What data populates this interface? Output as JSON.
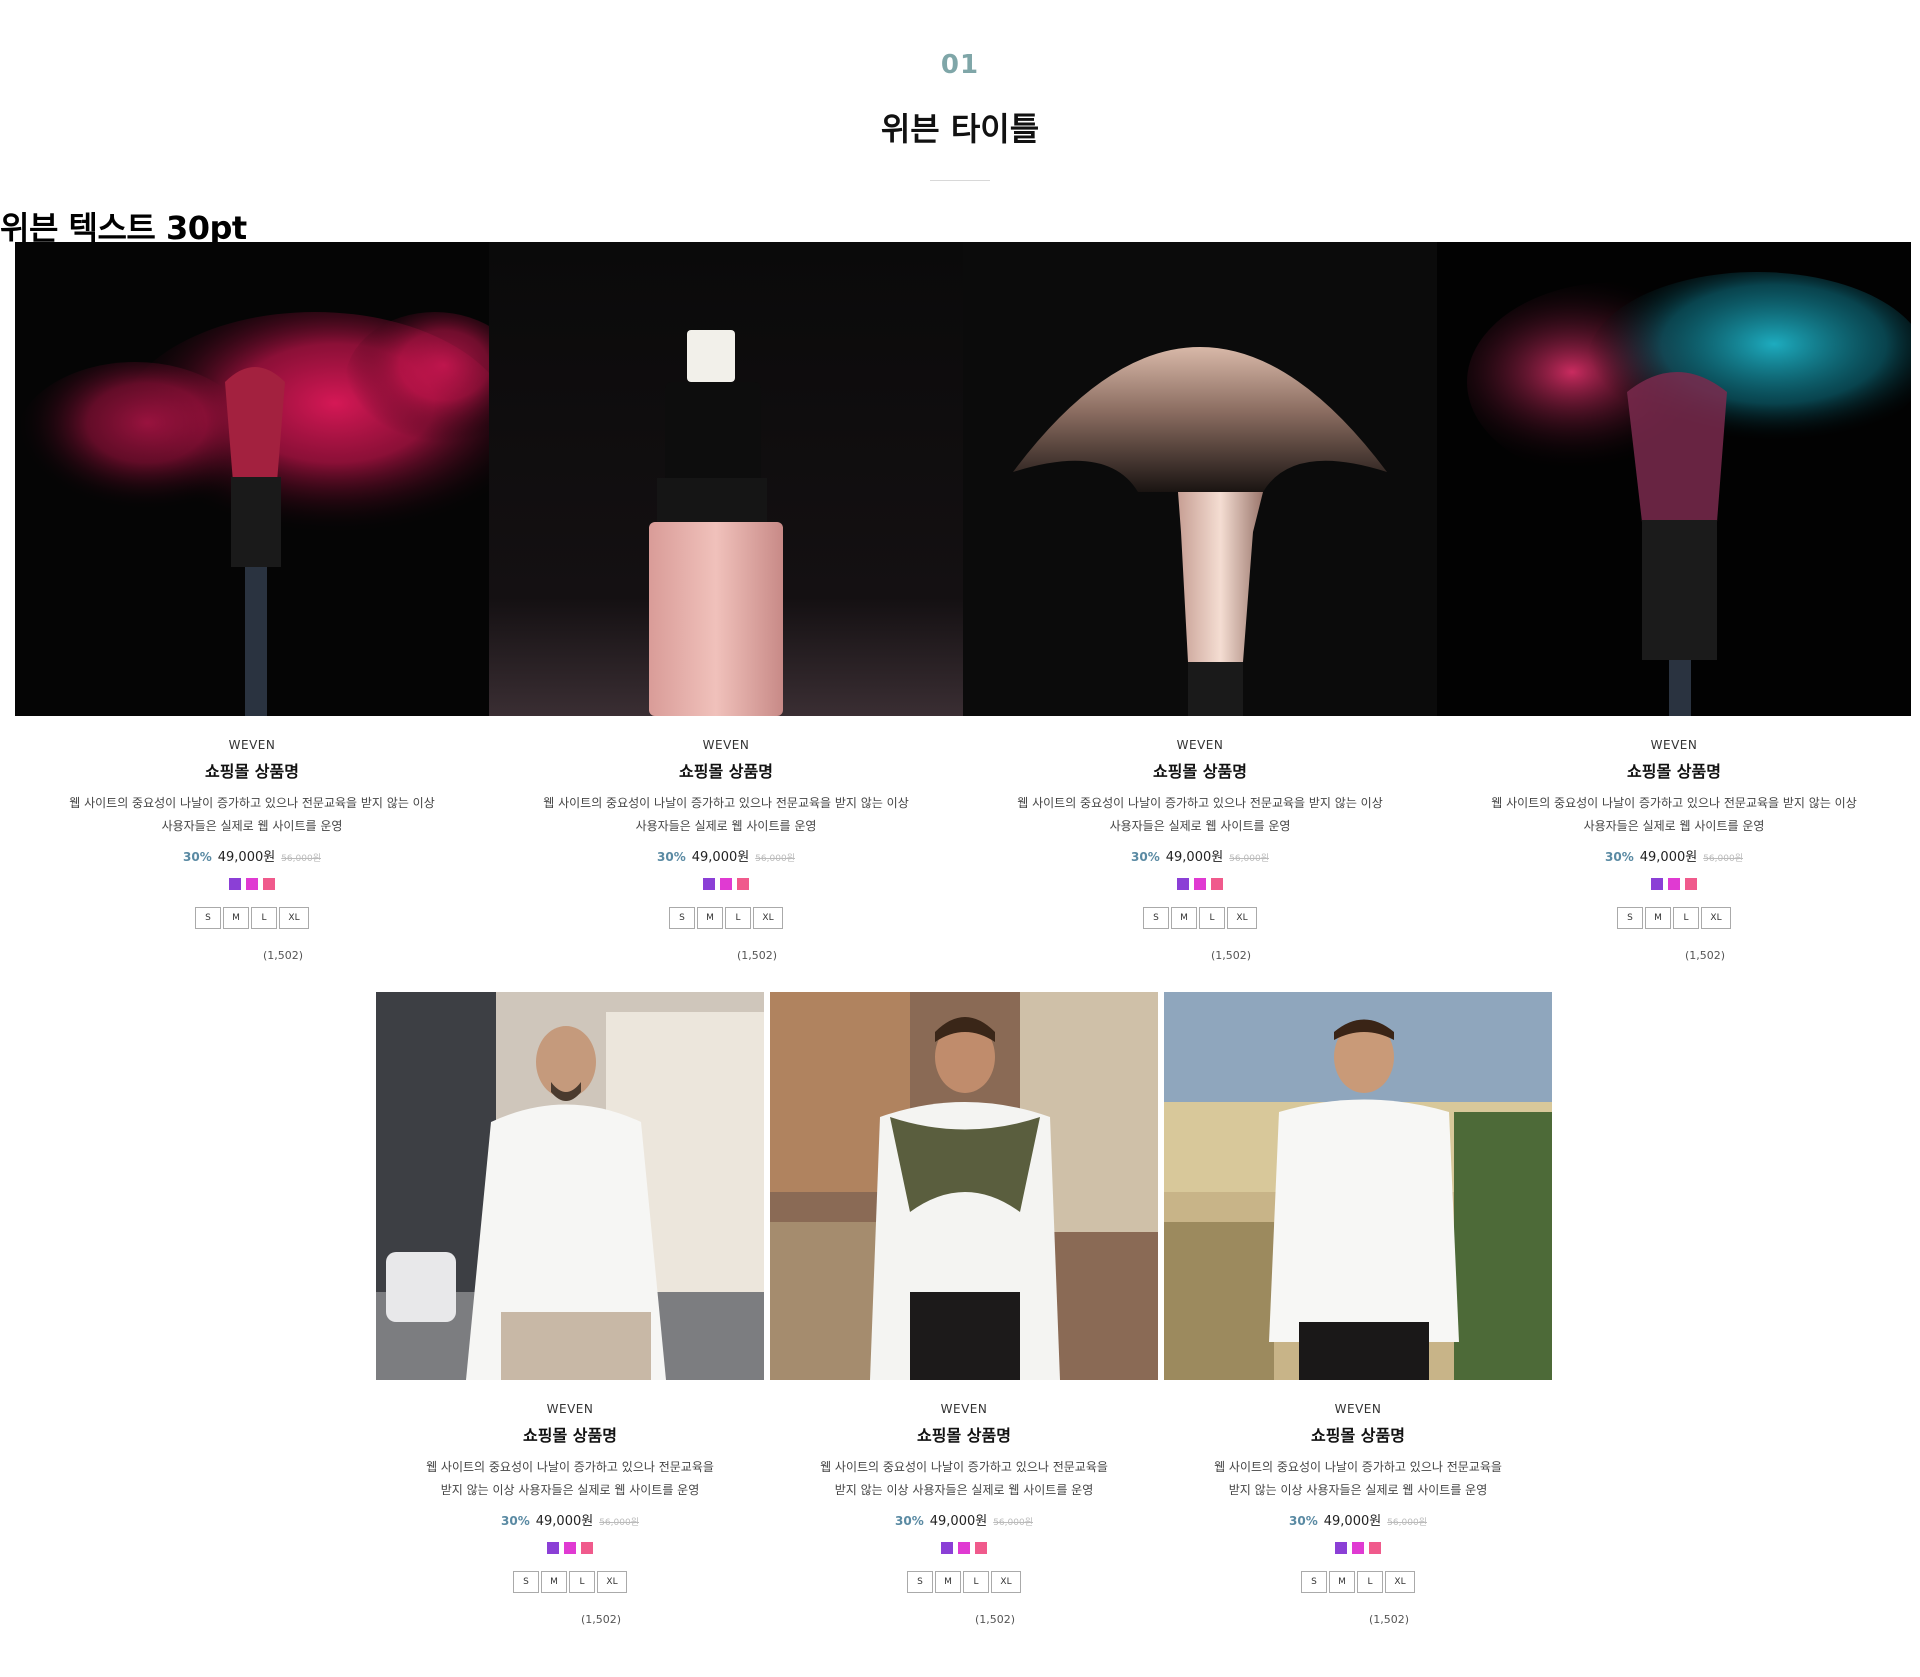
{
  "section": {
    "number": "01",
    "title": "위븐 타이틀",
    "subheading": "위븐 텍스트 30pt"
  },
  "products": [
    {
      "brand": "WEVEN",
      "name": "쇼핑몰 상품명",
      "desc_line1": "웹 사이트의 중요성이 나날이 증가하고 있으나 전문교육을 받지 않는 이상",
      "desc_line2": "사용자들은 실제로 웹 사이트를 운영",
      "discount": "30%",
      "price": "49,000원",
      "original_price": "56,000원",
      "sizes": [
        "S",
        "M",
        "L",
        "XL"
      ],
      "reviews": "(1,502)",
      "image": "pink-powder-brush"
    },
    {
      "brand": "WEVEN",
      "name": "쇼핑몰 상품명",
      "desc_line1": "웹 사이트의 중요성이 나날이 증가하고 있으나 전문교육을 받지 않는 이상",
      "desc_line2": "사용자들은 실제로 웹 사이트를 운영",
      "discount": "30%",
      "price": "49,000원",
      "original_price": "56,000원",
      "sizes": [
        "S",
        "M",
        "L",
        "XL"
      ],
      "reviews": "(1,502)",
      "image": "pump-bottle"
    },
    {
      "brand": "WEVEN",
      "name": "쇼핑몰 상품명",
      "desc_line1": "웹 사이트의 중요성이 나날이 증가하고 있으나 전문교육을 받지 않는 이상",
      "desc_line2": "사용자들은 실제로 웹 사이트를 운영",
      "discount": "30%",
      "price": "49,000원",
      "original_price": "56,000원",
      "sizes": [
        "S",
        "M",
        "L",
        "XL"
      ],
      "reviews": "(1,502)",
      "image": "fan-brush"
    },
    {
      "brand": "WEVEN",
      "name": "쇼핑몰 상품명",
      "desc_line1": "웹 사이트의 중요성이 나날이 증가하고 있으나 전문교육을 받지 않는 이상",
      "desc_line2": "사용자들은 실제로 웹 사이트를 운영",
      "discount": "30%",
      "price": "49,000원",
      "original_price": "56,000원",
      "sizes": [
        "S",
        "M",
        "L",
        "XL"
      ],
      "reviews": "(1,502)",
      "image": "blue-powder-brush"
    },
    {
      "brand": "WEVEN",
      "name": "쇼핑몰 상품명",
      "desc_line1": "웹 사이트의 중요성이 나날이 증가하고 있으나 전문교육을",
      "desc_line2": "받지 않는 이상 사용자들은 실제로 웹 사이트를 운영",
      "discount": "30%",
      "price": "49,000원",
      "original_price": "56,000원",
      "sizes": [
        "S",
        "M",
        "L",
        "XL"
      ],
      "reviews": "(1,502)",
      "image": "man-street-white-shirt"
    },
    {
      "brand": "WEVEN",
      "name": "쇼핑몰 상품명",
      "desc_line1": "웹 사이트의 중요성이 나날이 증가하고 있으나 전문교육을",
      "desc_line2": "받지 않는 이상 사용자들은 실제로 웹 사이트를 운영",
      "discount": "30%",
      "price": "49,000원",
      "original_price": "56,000원",
      "sizes": [
        "S",
        "M",
        "L",
        "XL"
      ],
      "reviews": "(1,502)",
      "image": "man-sweater-shoulders"
    },
    {
      "brand": "WEVEN",
      "name": "쇼핑몰 상품명",
      "desc_line1": "웹 사이트의 중요성이 나날이 증가하고 있으나 전문교육을",
      "desc_line2": "받지 않는 이상 사용자들은 실제로 웹 사이트를 운영",
      "discount": "30%",
      "price": "49,000원",
      "original_price": "56,000원",
      "sizes": [
        "S",
        "M",
        "L",
        "XL"
      ],
      "reviews": "(1,502)",
      "image": "man-sunglasses-hand"
    }
  ],
  "swatch_colors": [
    "#8b3fd6",
    "#e03ad2",
    "#f05a8c"
  ]
}
